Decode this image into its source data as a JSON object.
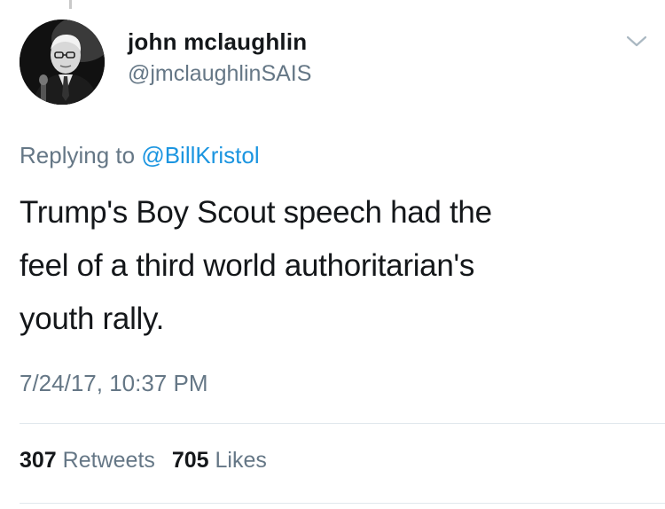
{
  "author": {
    "display_name": "john mclaughlin",
    "handle": "@jmclaughlinSAIS"
  },
  "reply": {
    "prefix": "Replying to",
    "mention": "@BillKristol"
  },
  "tweet": {
    "line1": "Trump's Boy Scout speech had the",
    "line2": "feel of a third world authoritarian's",
    "line3": "youth rally.",
    "timestamp": "7/24/17, 10:37 PM"
  },
  "stats": {
    "retweets_count": "307",
    "retweets_label": "Retweets",
    "likes_count": "705",
    "likes_label": "Likes"
  },
  "colors": {
    "text_primary": "#14171a",
    "text_secondary": "#657786",
    "link": "#1b95e0",
    "divider": "#e1e8ed"
  },
  "icons": {
    "menu": "chevron-down-icon"
  }
}
